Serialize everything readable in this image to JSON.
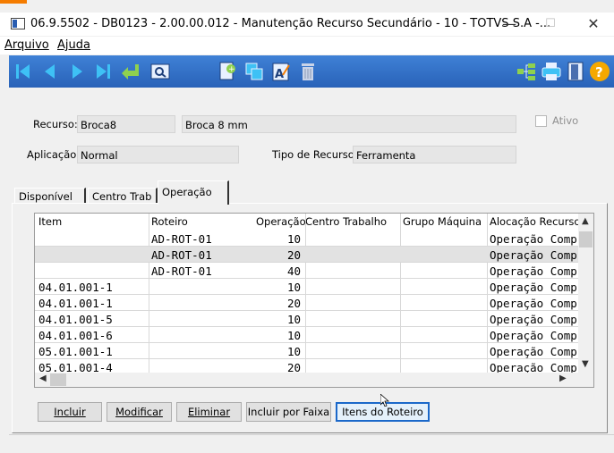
{
  "window": {
    "title": "06.9.5502 - DB0123 - 2.00.00.012 - Manutenção Recurso Secundário - 10 - TOTVS S.A -...",
    "minimize": "—",
    "maximize": "☐",
    "close": "✕"
  },
  "menu": {
    "arquivo": "Arquivo",
    "ajuda": "Ajuda"
  },
  "toolbar": {
    "icons": [
      "first-record-icon",
      "previous-record-icon",
      "next-record-icon",
      "last-record-icon",
      "return-icon",
      "search-icon",
      "new-record-icon",
      "copy-icon",
      "edit-icon",
      "delete-icon",
      "tree-icon",
      "print-icon",
      "exit-icon",
      "help-icon"
    ],
    "help_label": "?"
  },
  "form": {
    "recurso_label": "Recurso:",
    "recurso_code": "Broca8",
    "recurso_desc": "Broca 8 mm",
    "ativo_label": "Ativo",
    "aplicacao_label": "Aplicação:",
    "aplicacao_value": "Normal",
    "tipo_label": "Tipo de Recurso:",
    "tipo_value": "Ferramenta"
  },
  "tabs": [
    "Disponível",
    "Centro Trab",
    "Operação"
  ],
  "grid": {
    "headers": [
      "Item",
      "Roteiro",
      "Operação",
      "Centro Trabalho",
      "Grupo Máquina",
      "Alocação Recurso"
    ],
    "rows": [
      {
        "item": "",
        "roteiro": "AD-ROT-01",
        "operacao": "10",
        "centro": "",
        "grupo": "",
        "alocacao": "Operação Comp"
      },
      {
        "item": "",
        "roteiro": "AD-ROT-01",
        "operacao": "20",
        "centro": "",
        "grupo": "",
        "alocacao": "Operação Comp"
      },
      {
        "item": "",
        "roteiro": "AD-ROT-01",
        "operacao": "40",
        "centro": "",
        "grupo": "",
        "alocacao": "Operação Comp"
      },
      {
        "item": "04.01.001-1",
        "roteiro": "",
        "operacao": "10",
        "centro": "",
        "grupo": "",
        "alocacao": "Operação Comp"
      },
      {
        "item": "04.01.001-1",
        "roteiro": "",
        "operacao": "20",
        "centro": "",
        "grupo": "",
        "alocacao": "Operação Comp"
      },
      {
        "item": "04.01.001-5",
        "roteiro": "",
        "operacao": "10",
        "centro": "",
        "grupo": "",
        "alocacao": "Operação Comp"
      },
      {
        "item": "04.01.001-6",
        "roteiro": "",
        "operacao": "10",
        "centro": "",
        "grupo": "",
        "alocacao": "Operação Comp"
      },
      {
        "item": "05.01.001-1",
        "roteiro": "",
        "operacao": "10",
        "centro": "",
        "grupo": "",
        "alocacao": "Operação Comp"
      },
      {
        "item": "05.01.001-4",
        "roteiro": "",
        "operacao": "20",
        "centro": "",
        "grupo": "",
        "alocacao": "Operação Comp"
      }
    ],
    "selected_row": 1
  },
  "buttons": {
    "incluir": "Incluir",
    "modificar": "Modificar",
    "eliminar": "Eliminar",
    "incluir_faixa": "Incluir por Faixa",
    "itens_roteiro": "Itens do Roteiro"
  },
  "colors": {
    "toolbar": "#2962b8",
    "accent": "#f57c00",
    "selected_row": "#e2e2e2"
  }
}
